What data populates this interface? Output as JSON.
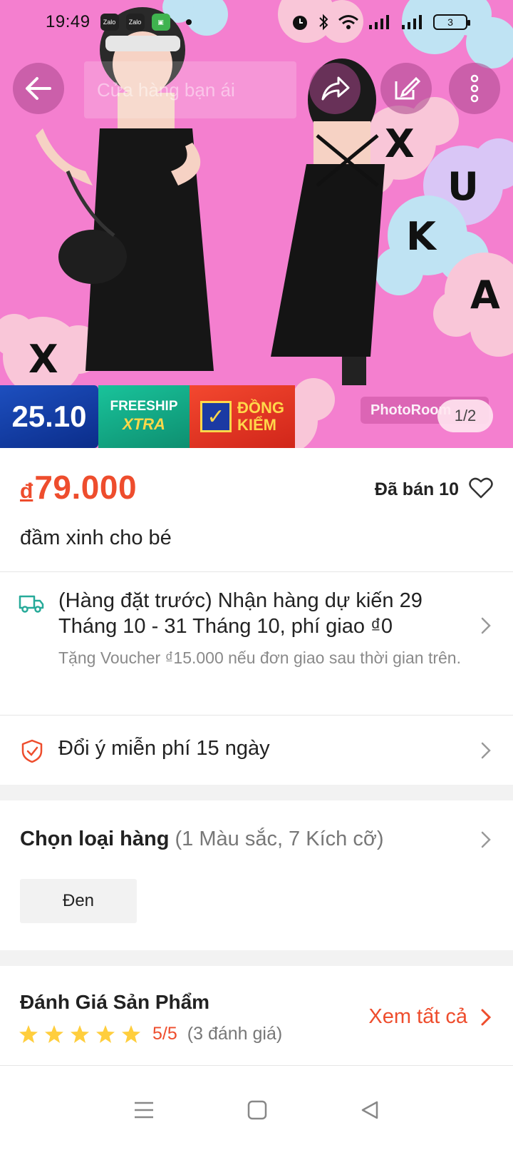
{
  "status_bar": {
    "time": "19:49",
    "apps": [
      "Zalo",
      "Zalo"
    ],
    "battery": "3"
  },
  "top_bar": {
    "search_placeholder": "Cửa hàng bạn ái"
  },
  "image": {
    "pager": "1/2",
    "watermark": "PhotoRoom",
    "promo_date": "25.10",
    "promo_freeship_line1": "FREESHIP",
    "promo_freeship_line2": "XTRA",
    "promo_dongkiem_line1": "ĐỒNG",
    "promo_dongkiem_line2": "KIỂM"
  },
  "product": {
    "currency": "đ",
    "price": "79.000",
    "sold": "Đã bán 10",
    "title": "đầm xinh cho bé"
  },
  "shipping": {
    "main": "(Hàng đặt trước) Nhận hàng dự kiến 29 Tháng 10 - 31 Tháng 10, phí giao ₫0",
    "sub": "Tặng Voucher ₫15.000 nếu đơn giao sau thời gian trên."
  },
  "returns": {
    "text": "Đổi ý miễn phí 15 ngày"
  },
  "variants": {
    "title": "Chọn loại hàng",
    "summary": "(1 Màu sắc, 7 Kích cỡ)",
    "options": [
      "Đen"
    ]
  },
  "reviews": {
    "title": "Đánh Giá Sản Phẩm",
    "stars": 5,
    "rating": "5/5",
    "count": "(3 đánh giá)",
    "see_all": "Xem tất cả"
  },
  "colors": {
    "accent": "#ee4d2d",
    "hero_bg": "#f47fcf",
    "ship_icon": "#26aa99",
    "star": "#ffce3d"
  }
}
